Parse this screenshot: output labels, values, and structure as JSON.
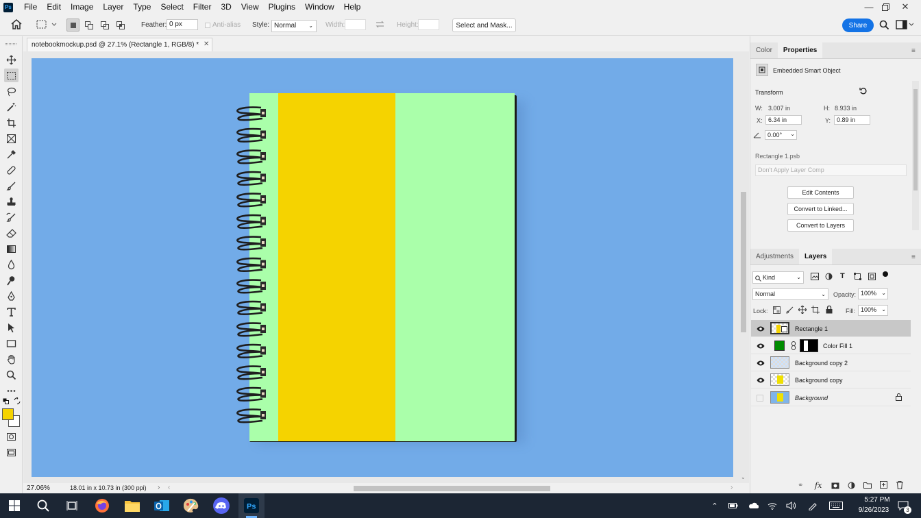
{
  "app": {
    "logo_text": "Ps",
    "menus": [
      "File",
      "Edit",
      "Image",
      "Layer",
      "Type",
      "Select",
      "Filter",
      "3D",
      "View",
      "Plugins",
      "Window",
      "Help"
    ]
  },
  "options_bar": {
    "feather_label": "Feather:",
    "feather_value": "0 px",
    "anti_alias_label": "Anti-alias",
    "style_label": "Style:",
    "style_value": "Normal",
    "width_label": "Width:",
    "height_label": "Height:",
    "select_mask_label": "Select and Mask...",
    "share_label": "Share"
  },
  "document": {
    "tab_title": "notebookmockup.psd @ 27.1% (Rectangle 1, RGB/8) *",
    "zoom": "27.06%",
    "doc_info": "18.01 in x 10.73 in (300 ppi)"
  },
  "colors": {
    "foreground": "#f5d300",
    "background": "#ffffff",
    "canvas_bg": "#72abe8",
    "notebook_yellow": "#f5d300",
    "notebook_green": "#aaffaa",
    "accent": "#1473e6"
  },
  "properties_panel": {
    "tabs": [
      "Color",
      "Properties"
    ],
    "object_type": "Embedded Smart Object",
    "transform_label": "Transform",
    "w_label": "W:",
    "w_value": "3.007 in",
    "h_label": "H:",
    "h_value": "8.933 in",
    "x_label": "X:",
    "x_value": "6.34 in",
    "y_label": "Y:",
    "y_value": "0.89 in",
    "angle_value": "0.00°",
    "file_name": "Rectangle 1.psb",
    "layer_comp": "Don't Apply Layer Comp",
    "buttons": [
      "Edit Contents",
      "Convert to Linked...",
      "Convert to Layers"
    ]
  },
  "layers_panel": {
    "tabs": [
      "Adjustments",
      "Layers"
    ],
    "filter_label": "Kind",
    "blend_mode": "Normal",
    "opacity_label": "Opacity:",
    "opacity_value": "100%",
    "lock_label": "Lock:",
    "fill_label": "Fill:",
    "fill_value": "100%",
    "layers": [
      {
        "name": "Rectangle 1",
        "visible": true,
        "selected": true
      },
      {
        "name": "Color Fill 1",
        "visible": true,
        "selected": false
      },
      {
        "name": "Background copy 2",
        "visible": true,
        "selected": false
      },
      {
        "name": "Background copy",
        "visible": true,
        "selected": false
      },
      {
        "name": "Background",
        "visible": false,
        "selected": false,
        "locked": true
      }
    ]
  },
  "taskbar": {
    "time": "5:27 PM",
    "date": "9/26/2023",
    "notification_count": "3"
  }
}
